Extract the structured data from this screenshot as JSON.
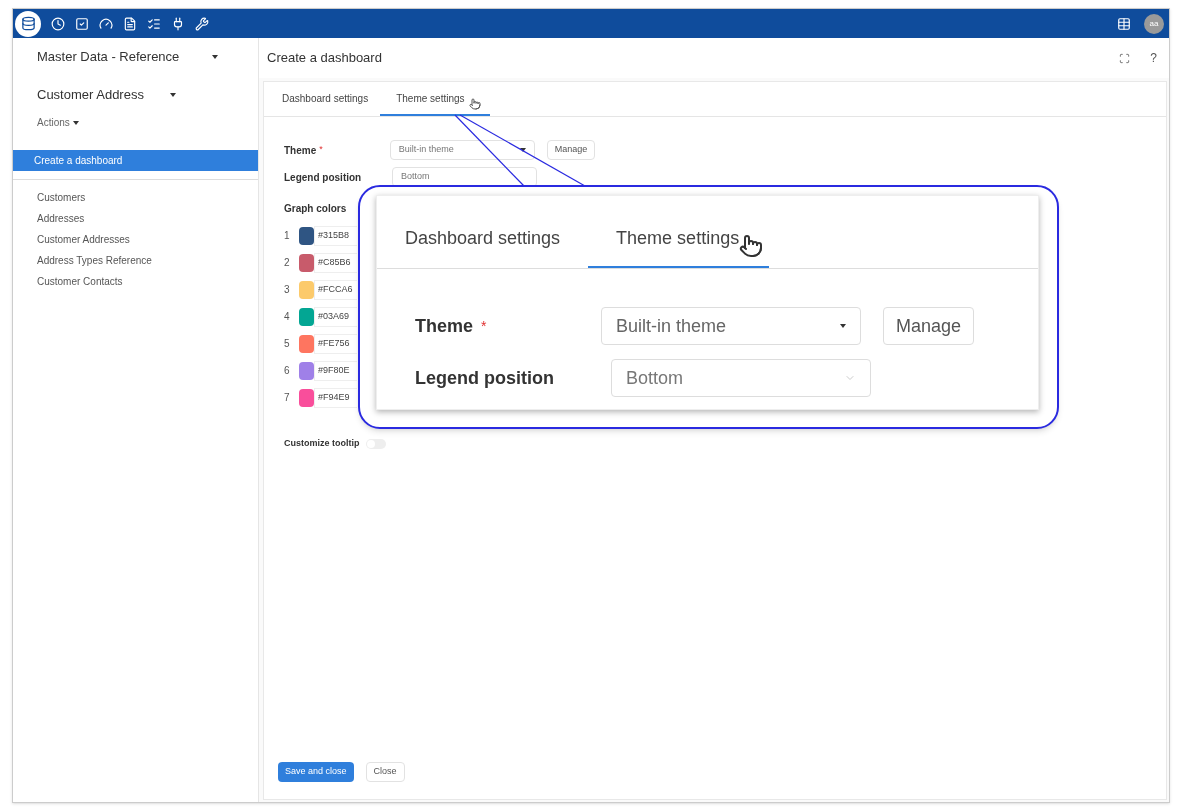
{
  "toolbar": {
    "avatar": "aa"
  },
  "sidebar": {
    "module": "Master Data - Reference",
    "entity": "Customer Address",
    "actions": "Actions",
    "items": [
      {
        "label": "Create a dashboard",
        "selected": true
      }
    ],
    "links": [
      "Customers",
      "Addresses",
      "Customer Addresses",
      "Address Types Reference",
      "Customer Contacts"
    ]
  },
  "page_title": "Create a dashboard",
  "help": "?",
  "tabs": [
    {
      "label": "Dashboard settings",
      "selected": false
    },
    {
      "label": "Theme settings",
      "selected": true
    }
  ],
  "form": {
    "theme_label": "Theme",
    "required_mark": "*",
    "theme_value": "Built-in theme",
    "manage": "Manage",
    "legend_label": "Legend position",
    "legend_value": "Bottom",
    "graph_colors_label": "Graph colors",
    "graph_colors": [
      {
        "index": "1",
        "color": "#2f5583",
        "hex": "#315B8"
      },
      {
        "index": "2",
        "color": "#c85b6b",
        "hex": "#C85B6"
      },
      {
        "index": "3",
        "color": "#fcca6b",
        "hex": "#FCCA6"
      },
      {
        "index": "4",
        "color": "#03a693",
        "hex": "#03A69"
      },
      {
        "index": "5",
        "color": "#fe7560",
        "hex": "#FE756"
      },
      {
        "index": "6",
        "color": "#9f80e8",
        "hex": "#9F80E"
      },
      {
        "index": "7",
        "color": "#f94e9b",
        "hex": "#F94E9"
      }
    ],
    "tooltip_label": "Customize tooltip",
    "tooltip_on": false
  },
  "callout": {
    "tabs": [
      {
        "label": "Dashboard settings",
        "selected": false
      },
      {
        "label": "Theme settings",
        "selected": true
      }
    ],
    "theme_label": "Theme",
    "required_mark": "*",
    "theme_value": "Built-in theme",
    "manage": "Manage",
    "legend_label": "Legend position",
    "legend_value": "Bottom"
  },
  "footer": {
    "save": "Save and close",
    "close": "Close"
  }
}
